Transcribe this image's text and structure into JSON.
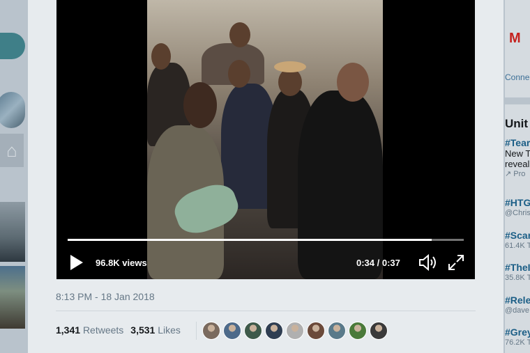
{
  "left_sidebar": {
    "home_icon": "house-icon"
  },
  "video": {
    "views": "96.8K views",
    "time": "0:34 / 0:37",
    "progress_fraction": 0.9189,
    "icons": {
      "play": "play-icon",
      "volume": "volume-icon",
      "fullscreen": "fullscreen-icon"
    }
  },
  "tweet": {
    "timestamp": "8:13 PM - 18 Jan 2018",
    "retweets_count": "1,341",
    "retweets_label": "Retweets",
    "likes_count": "3,531",
    "likes_label": "Likes",
    "liker_colors": [
      "#7a6a5e",
      "#4d6a8a",
      "#3e5a4a",
      "#2f3e52",
      "#b0b0b0",
      "#6b4a3a",
      "#5a7a8a",
      "#4a7a3a",
      "#3a3a3a"
    ]
  },
  "right_sidebar": {
    "gmail_label": "M",
    "connect_label": "Conne",
    "trends_title": "Unit",
    "trends": [
      {
        "tag": "#Tear",
        "sub": "New T",
        "extra": "reveal",
        "promoted": "Pro"
      },
      {
        "tag": "#HTG",
        "sub": "@Chris"
      },
      {
        "tag": "#Scar",
        "sub": "61.4K T"
      },
      {
        "tag": "#TheI",
        "sub": "35.8K T"
      },
      {
        "tag": "#Rele",
        "sub": "@dave"
      },
      {
        "tag": "#Grey",
        "sub": "76.2K T"
      }
    ]
  },
  "colors": {
    "page_dim": "#b9c3cc",
    "card_bg": "#e7ebee",
    "link": "#1b5e86",
    "muted": "#657786"
  }
}
